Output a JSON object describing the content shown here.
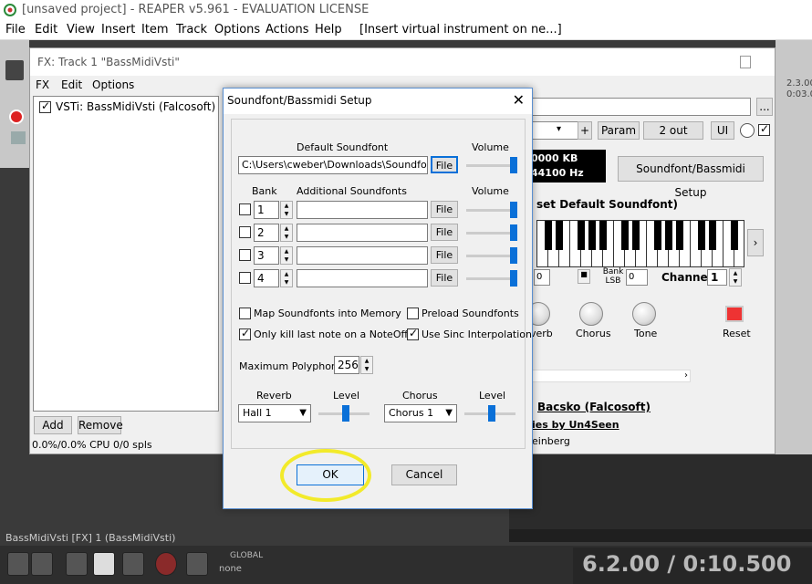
{
  "app": {
    "title": "[unsaved project] - REAPER v5.961 - EVALUATION LICENSE"
  },
  "menu": [
    "File",
    "Edit",
    "View",
    "Insert",
    "Item",
    "Track",
    "Options",
    "Actions",
    "Help",
    "[Insert virtual instrument on ne...]"
  ],
  "fx_window": {
    "title": "FX: Track 1 \"BassMidiVsti\"",
    "menu": [
      "FX",
      "Edit",
      "Options"
    ],
    "plugin_item": "VSTi: BassMidiVsti (Falcosoft)",
    "add_label": "Add",
    "remove_label": "Remove",
    "cpu": "0.0%/0.0% CPU 0/0 spls",
    "param_label": "Param",
    "out_label": "2 out",
    "ui_label": "UI",
    "plus_label": "+",
    "ellipsis_label": "...",
    "lcd_line1": "0000 KB",
    "lcd_line2": "44100 Hz",
    "setup_button": "Soundfont/Bassmidi Setup",
    "default_sf_text": "set Default Soundfont)",
    "bank_lsb": "Bank LSB",
    "bank_lsb_value": "0",
    "program_value": "0",
    "channel_label": "Channel",
    "channel_value": "1",
    "knobs": [
      "verb",
      "Chorus",
      "Tone"
    ],
    "reset_label": "Reset",
    "credit1": "Bacsko (Falcosoft)",
    "credit2": "ies by Un4Seen",
    "credit3": "einberg"
  },
  "dialog": {
    "title": "Soundfont/Bassmidi Setup",
    "default_sf_label": "Default Soundfont",
    "volume_label": "Volume",
    "default_sf_path": "C:\\Users\\cweber\\Downloads\\Soundfonts\\F",
    "file_label": "File",
    "bank_label": "Bank",
    "additional_label": "Additional Soundfonts",
    "banks": [
      {
        "bank": "1",
        "path": "",
        "volume": 1.0
      },
      {
        "bank": "2",
        "path": "",
        "volume": 1.0
      },
      {
        "bank": "3",
        "path": "",
        "volume": 1.0
      },
      {
        "bank": "4",
        "path": "",
        "volume": 1.0
      }
    ],
    "default_volume": 1.0,
    "opt_map": "Map Soundfonts into Memory",
    "opt_preload": "Preload Soundfonts",
    "opt_kill": "Only kill last note on a NoteOff",
    "opt_sinc": "Use Sinc Interpolation",
    "opt_map_checked": false,
    "opt_preload_checked": false,
    "opt_kill_checked": true,
    "opt_sinc_checked": true,
    "polyphony_label": "Maximum Polyphony",
    "polyphony_value": "256",
    "reverb_label": "Reverb",
    "reverb_value": "Hall 1",
    "chorus_label": "Chorus",
    "chorus_value": "Chorus 1",
    "level_label": "Level",
    "ok_label": "OK",
    "cancel_label": "Cancel"
  },
  "status": "BassMidiVsti [FX] 1 (BassMidiVsti)",
  "transport": {
    "global_label": "GLOBAL",
    "none_label": "none",
    "time": "6.2.00 / 0:10.500"
  },
  "ruler": [
    "2.3.00",
    "0:03.0"
  ],
  "colors": {
    "accent": "#0a70d8",
    "highlight": "#f2ea2a"
  }
}
